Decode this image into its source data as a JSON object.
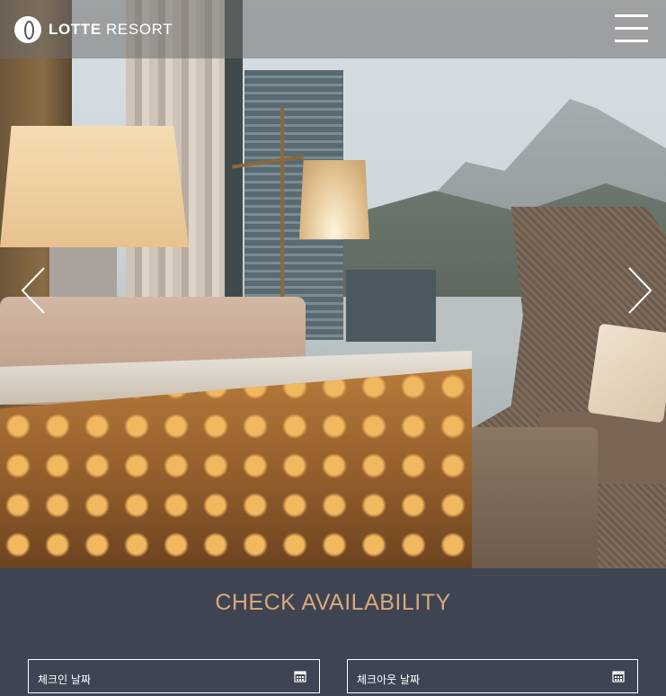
{
  "header": {
    "logo_bold": "LOTTE",
    "logo_regular": "RESORT",
    "menu_icon": "hamburger-menu-icon"
  },
  "hero": {
    "image_alt": "Hotel room interior with lamps, lounge chair and mountain city view",
    "prev_icon": "chevron-left-icon",
    "next_icon": "chevron-right-icon"
  },
  "availability": {
    "title": "CHECK AVAILABILITY",
    "checkin_label": "체크인 날짜",
    "checkout_label": "체크아웃 날짜",
    "calendar_icon": "calendar-icon"
  },
  "colors": {
    "panel_bg": "#3e4452",
    "title_accent": "#d9a97a",
    "header_overlay": "rgba(110,110,110,0.55)"
  }
}
